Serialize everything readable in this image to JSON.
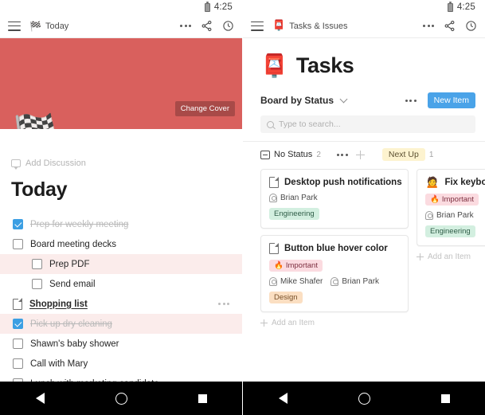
{
  "statusbar": {
    "time": "4:25",
    "battery_icon": "battery-icon"
  },
  "left_phone": {
    "appbar": {
      "menu_icon": "hamburger-menu-icon",
      "flag_icon": "🏁",
      "title": "Today",
      "more_icon": "more-options-icon",
      "share_icon": "share-icon",
      "history_icon": "clock-icon"
    },
    "cover": {
      "emoji": "🏁",
      "change_cover_label": "Change Cover"
    },
    "add_discussion": "Add Discussion",
    "page_title": "Today",
    "tasks": [
      {
        "label": "Prep for weekly meeting",
        "checked": true,
        "indent": false,
        "highlight": false,
        "type": "checkbox"
      },
      {
        "label": "Board meeting decks",
        "checked": false,
        "indent": false,
        "highlight": false,
        "type": "checkbox"
      },
      {
        "label": "Prep PDF",
        "checked": false,
        "indent": true,
        "highlight": true,
        "type": "checkbox"
      },
      {
        "label": "Send email",
        "checked": false,
        "indent": true,
        "highlight": false,
        "type": "checkbox"
      },
      {
        "label": "Shopping list",
        "checked": false,
        "indent": false,
        "highlight": false,
        "type": "document",
        "has_menu": true
      },
      {
        "label": "Pick up dry cleaning",
        "checked": true,
        "indent": false,
        "highlight": true,
        "type": "checkbox"
      },
      {
        "label": "Shawn's baby shower",
        "checked": false,
        "indent": false,
        "highlight": false,
        "type": "checkbox"
      },
      {
        "label": "Call with Mary",
        "checked": false,
        "indent": false,
        "highlight": false,
        "type": "checkbox"
      },
      {
        "label": "Lunch with marketing candidate",
        "checked": false,
        "indent": false,
        "highlight": false,
        "type": "checkbox"
      }
    ]
  },
  "right_phone": {
    "appbar": {
      "menu_icon": "hamburger-menu-icon",
      "mailbox_icon": "📮",
      "title": "Tasks & Issues",
      "more_icon": "more-options-icon",
      "share_icon": "share-icon",
      "history_icon": "clock-icon"
    },
    "page": {
      "emoji": "📮",
      "title": "Tasks"
    },
    "board": {
      "view_label": "Board by Status",
      "more_icon": "more-options-icon",
      "new_item_label": "New Item",
      "search_placeholder": "Type to search..."
    },
    "columns": [
      {
        "name": "No Status",
        "count": "2",
        "icon": "inbox-icon",
        "add_item_label": "Add an Item",
        "cards": [
          {
            "title": "Desktop push notifications",
            "icon": "document-icon",
            "emoji": "",
            "priority": "",
            "assignees": [
              "Brian Park"
            ],
            "tag": "Engineering",
            "tag_type": "engineering"
          },
          {
            "title": "Button blue hover color",
            "icon": "document-icon",
            "emoji": "",
            "priority": "Important",
            "assignees": [
              "Mike Shafer",
              "Brian Park"
            ],
            "tag": "Design",
            "tag_type": "design"
          }
        ]
      },
      {
        "name": "Next Up",
        "count": "1",
        "icon": "",
        "add_item_label": "Add an Item",
        "cards": [
          {
            "title": "Fix keyboa",
            "icon": "",
            "emoji": "🙍",
            "priority": "Important",
            "assignees": [
              "Brian Park"
            ],
            "tag": "Engineering",
            "tag_type": "engineering"
          }
        ]
      }
    ],
    "priority_emoji": "🔥"
  },
  "navbar": {
    "back_icon": "back-triangle-icon",
    "home_icon": "home-circle-icon",
    "recents_icon": "recents-square-icon"
  }
}
